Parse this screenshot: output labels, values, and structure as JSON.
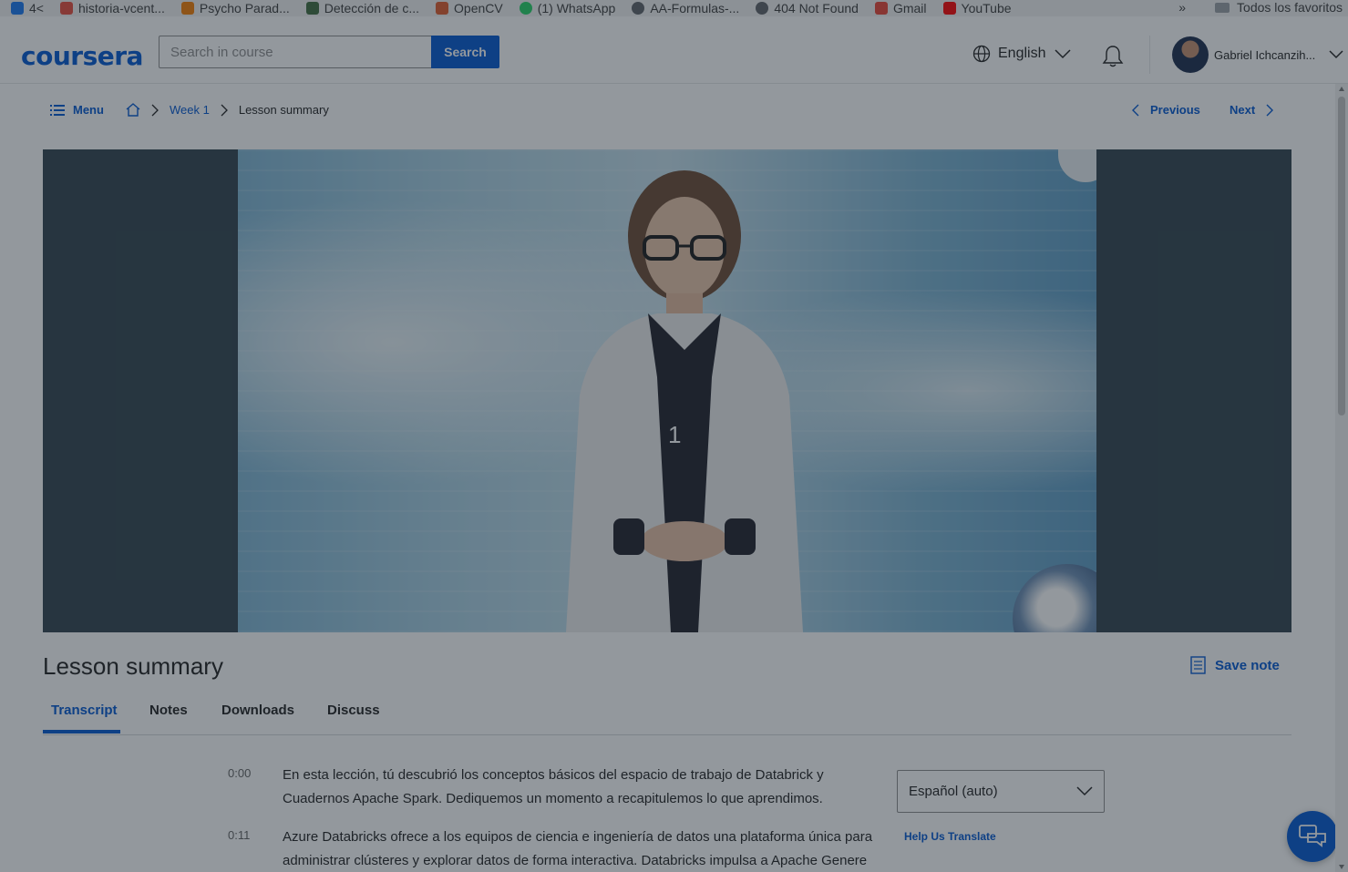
{
  "bookmarks": {
    "items": [
      {
        "label": "4<",
        "icon": "facebook-icon",
        "color": "#1877f2"
      },
      {
        "label": "historia-vcent...",
        "icon": "pinwheel-icon",
        "color": "#e94b3c"
      },
      {
        "label": "Psycho Parad...",
        "icon": "blogger-icon",
        "color": "#f57d00"
      },
      {
        "label": "Detección de c...",
        "icon": "site-icon",
        "color": "#3f6b3f"
      },
      {
        "label": "OpenCV",
        "icon": "opencv-icon",
        "color": "#e05a2b"
      },
      {
        "label": "(1) WhatsApp",
        "icon": "whatsapp-icon",
        "color": "#25d366"
      },
      {
        "label": "AA-Formulas-...",
        "icon": "globe-icon",
        "color": "#5f6368"
      },
      {
        "label": "404 Not Found",
        "icon": "globe-icon",
        "color": "#5f6368"
      },
      {
        "label": "Gmail",
        "icon": "gmail-icon",
        "color": "#ea4335"
      },
      {
        "label": "YouTube",
        "icon": "youtube-icon",
        "color": "#ff0000"
      }
    ],
    "more": "»",
    "folder_label": "Todos los favoritos"
  },
  "header": {
    "logo": "coursera",
    "search_placeholder": "Search in course",
    "search_button": "Search",
    "language": "English",
    "user_name": "Gabriel Ichcanzih..."
  },
  "nav": {
    "menu_label": "Menu",
    "crumb_week": "Week 1",
    "crumb_current": "Lesson summary",
    "previous": "Previous",
    "next": "Next"
  },
  "video": {
    "counter": "1"
  },
  "lesson": {
    "title": "Lesson summary",
    "save_note": "Save note",
    "tabs": [
      "Transcript",
      "Notes",
      "Downloads",
      "Discuss"
    ],
    "active_tab": "Transcript"
  },
  "transcript": {
    "rows": [
      {
        "time": "0:00",
        "text": "En esta lección, tú descubrió los conceptos básicos del espacio de trabajo de Databrick y Cuadernos Apache Spark. Dediquemos un momento a recapitulemos lo que aprendimos."
      },
      {
        "time": "0:11",
        "text": "Azure Databricks ofrece a los equipos de ciencia e ingeniería de datos una plataforma única para administrar clústeres y explorar datos de forma interactiva. Databricks impulsa a Apache Genere"
      }
    ],
    "language_select": "Español (auto)",
    "help_translate": "Help Us Translate"
  },
  "colors": {
    "brand": "#0056d2",
    "text": "#1f1f1f",
    "overlay": "rgba(30,40,50,0.48)"
  }
}
